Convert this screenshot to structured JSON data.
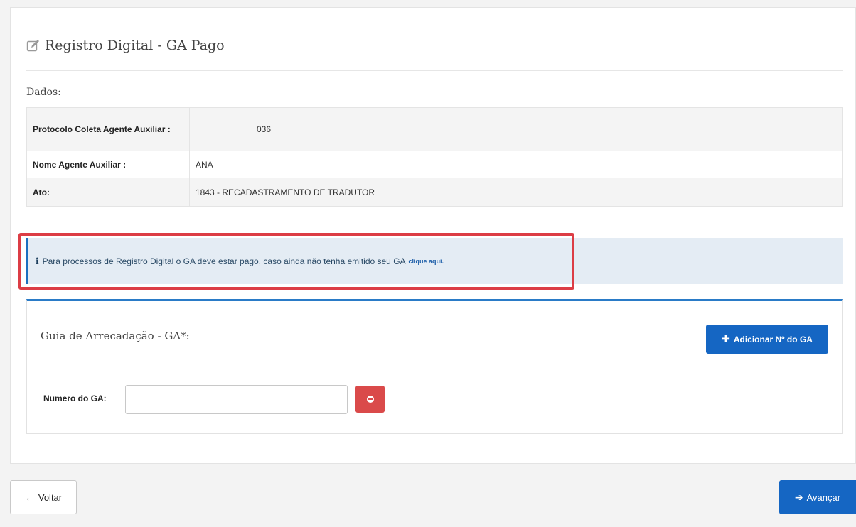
{
  "header": {
    "title": "Registro Digital - GA Pago",
    "title_icon": "edit-icon"
  },
  "dados": {
    "label": "Dados:",
    "rows": [
      {
        "key": "Protocolo Coleta Agente Auxiliar :",
        "value": "036"
      },
      {
        "key": "Nome Agente Auxiliar :",
        "value": "ANA"
      },
      {
        "key": "Ato:",
        "value": "1843 - RECADASTRAMENTO DE TRADUTOR"
      }
    ]
  },
  "alert": {
    "icon": "info-icon",
    "icon_glyph": "i",
    "text": "Para processos de Registro Digital o GA deve estar pago, caso ainda não tenha emitido seu GA",
    "link_text": "clique aqui."
  },
  "ga": {
    "title": "Guia de Arrecadação - GA*:",
    "add_button_label": "Adicionar Nº do GA",
    "field_label": "Numero do GA:",
    "field_value": "",
    "field_placeholder": ""
  },
  "footer": {
    "back_label": "Voltar",
    "next_label": "Avançar"
  },
  "colors": {
    "primary": "#1566c3",
    "danger": "#da4a4a",
    "highlight": "#dc3d45",
    "alert_bg": "#e4ecf4"
  }
}
